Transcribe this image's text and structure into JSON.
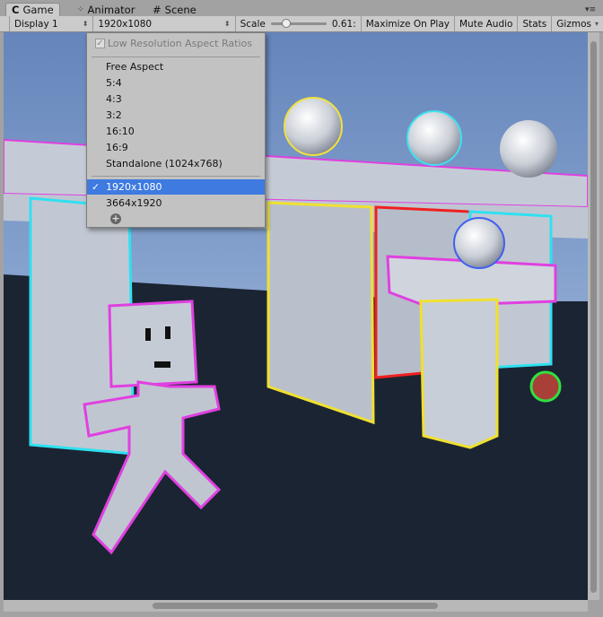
{
  "tabs": [
    {
      "label": "Game",
      "icon": "pacman-icon",
      "active": true
    },
    {
      "label": "Animator",
      "icon": "animator-icon",
      "active": false
    },
    {
      "label": "Scene",
      "icon": "grid-icon",
      "active": false
    }
  ],
  "toolbar": {
    "display": "Display 1",
    "resolution": "1920x1080",
    "scale_label": "Scale",
    "scale_value": "0.61:",
    "scale_fraction": 0.2,
    "maximize": "Maximize On Play",
    "mute": "Mute Audio",
    "stats": "Stats",
    "gizmos": "Gizmos"
  },
  "dropdown": {
    "low_res": "Low Resolution Aspect Ratios",
    "low_res_checked": true,
    "items": [
      "Free Aspect",
      "5:4",
      "4:3",
      "3:2",
      "16:10",
      "16:9",
      "Standalone (1024x768)"
    ],
    "custom": [
      "1920x1080",
      "3664x1920"
    ],
    "selected": "1920x1080",
    "check": "✓",
    "add": "+"
  },
  "colors": {
    "selection": "#3e7ae0",
    "floor": "#1b2433",
    "sky": "#7393c4"
  }
}
